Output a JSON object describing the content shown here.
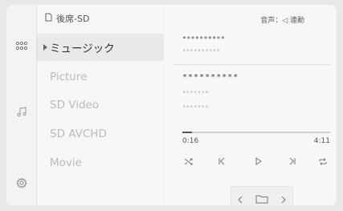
{
  "source": {
    "label": "後席-SD"
  },
  "list": {
    "items": [
      {
        "label": "ミュージック",
        "active": true
      },
      {
        "label": "Picture"
      },
      {
        "label": "SD Video"
      },
      {
        "label": "SD AVCHD"
      },
      {
        "label": "Movie"
      }
    ]
  },
  "audio_output": {
    "label": "音声：◁ 連動"
  },
  "track": {
    "line1": "**********",
    "line2": "**********",
    "line3": "**********",
    "line4": "*******",
    "line5": "*******"
  },
  "playback": {
    "current": "0:16",
    "total": "4:11",
    "progress_fraction": 0.064
  },
  "colors": {
    "active_bg": "#e9e9e9",
    "text_active": "#333333",
    "text_inactive": "#bbbbbb"
  }
}
